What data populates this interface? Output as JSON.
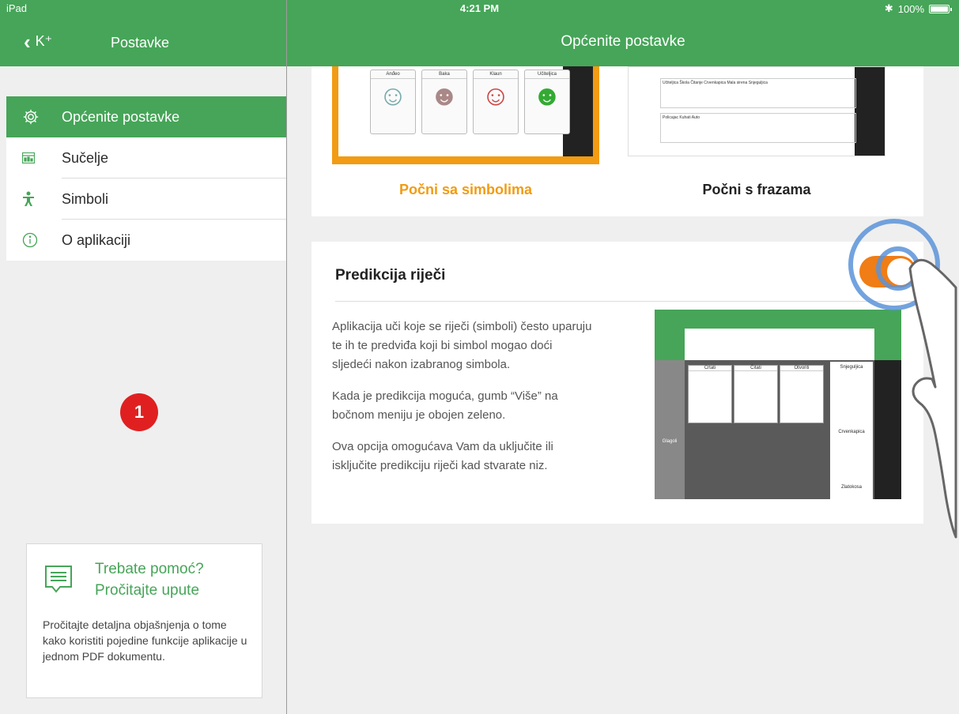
{
  "status_bar": {
    "device": "iPad",
    "time": "4:21 PM",
    "battery": "100%"
  },
  "nav": {
    "back_label": "K⁺",
    "sidebar_title": "Postavke",
    "main_title": "Općenite postavke"
  },
  "sidebar": {
    "items": [
      {
        "label": "Općenite postavke",
        "icon": "gear-icon",
        "active": true
      },
      {
        "label": "Sučelje",
        "icon": "interface-icon",
        "active": false
      },
      {
        "label": "Simboli",
        "icon": "symbol-person-icon",
        "active": false
      },
      {
        "label": "O aplikaciji",
        "icon": "info-icon",
        "active": false
      }
    ],
    "badge": "1",
    "help": {
      "title": "Trebate pomoć? Pročitajte upute",
      "body": "Pročitajte detaljna objašnjenja o tome kako koristiti pojedine funkcije aplikacije u jednom PDF dokumentu."
    }
  },
  "main": {
    "start_options": {
      "symbols_label": "Počni sa simbolima",
      "phrases_label": "Počni s frazama",
      "symbol_cells": [
        "Anđeo",
        "Baka",
        "Klaun",
        "Učiteljica"
      ],
      "phrase_row1": [
        "Učiteljica",
        "Škola",
        "Čitanje",
        "Crvenkapica",
        "Mala sirena",
        "Snjeguljica"
      ],
      "phrase_row2": [
        "Policajac",
        "Kuhati",
        "Auto"
      ]
    },
    "prediction": {
      "title": "Predikcija riječi",
      "toggle_on": true,
      "paragraphs": [
        "Aplikacija uči koje se riječi (simboli) često uparuju te ih te predviđa koji bi simbol mogao doći sljedeći nakon izabranog simbola.",
        "Kada je predikcija moguća, gumb “Više” na bočnom meniju je obojen zeleno.",
        "Ova opcija omogućava Vam da uključite ili isključite predikciju riječi kad stvarate niz."
      ],
      "screenshot_cells": [
        "Crtati",
        "Čitati",
        "Otvoriti"
      ],
      "screenshot_words": [
        "Snjeguljica",
        "Crvenkapica",
        "Zlatokosa"
      ],
      "screenshot_side": "Glagoli"
    }
  },
  "colors": {
    "green": "#46a558",
    "orange": "#f29b13",
    "toggle": "#f07d15",
    "badge": "#e02020"
  }
}
